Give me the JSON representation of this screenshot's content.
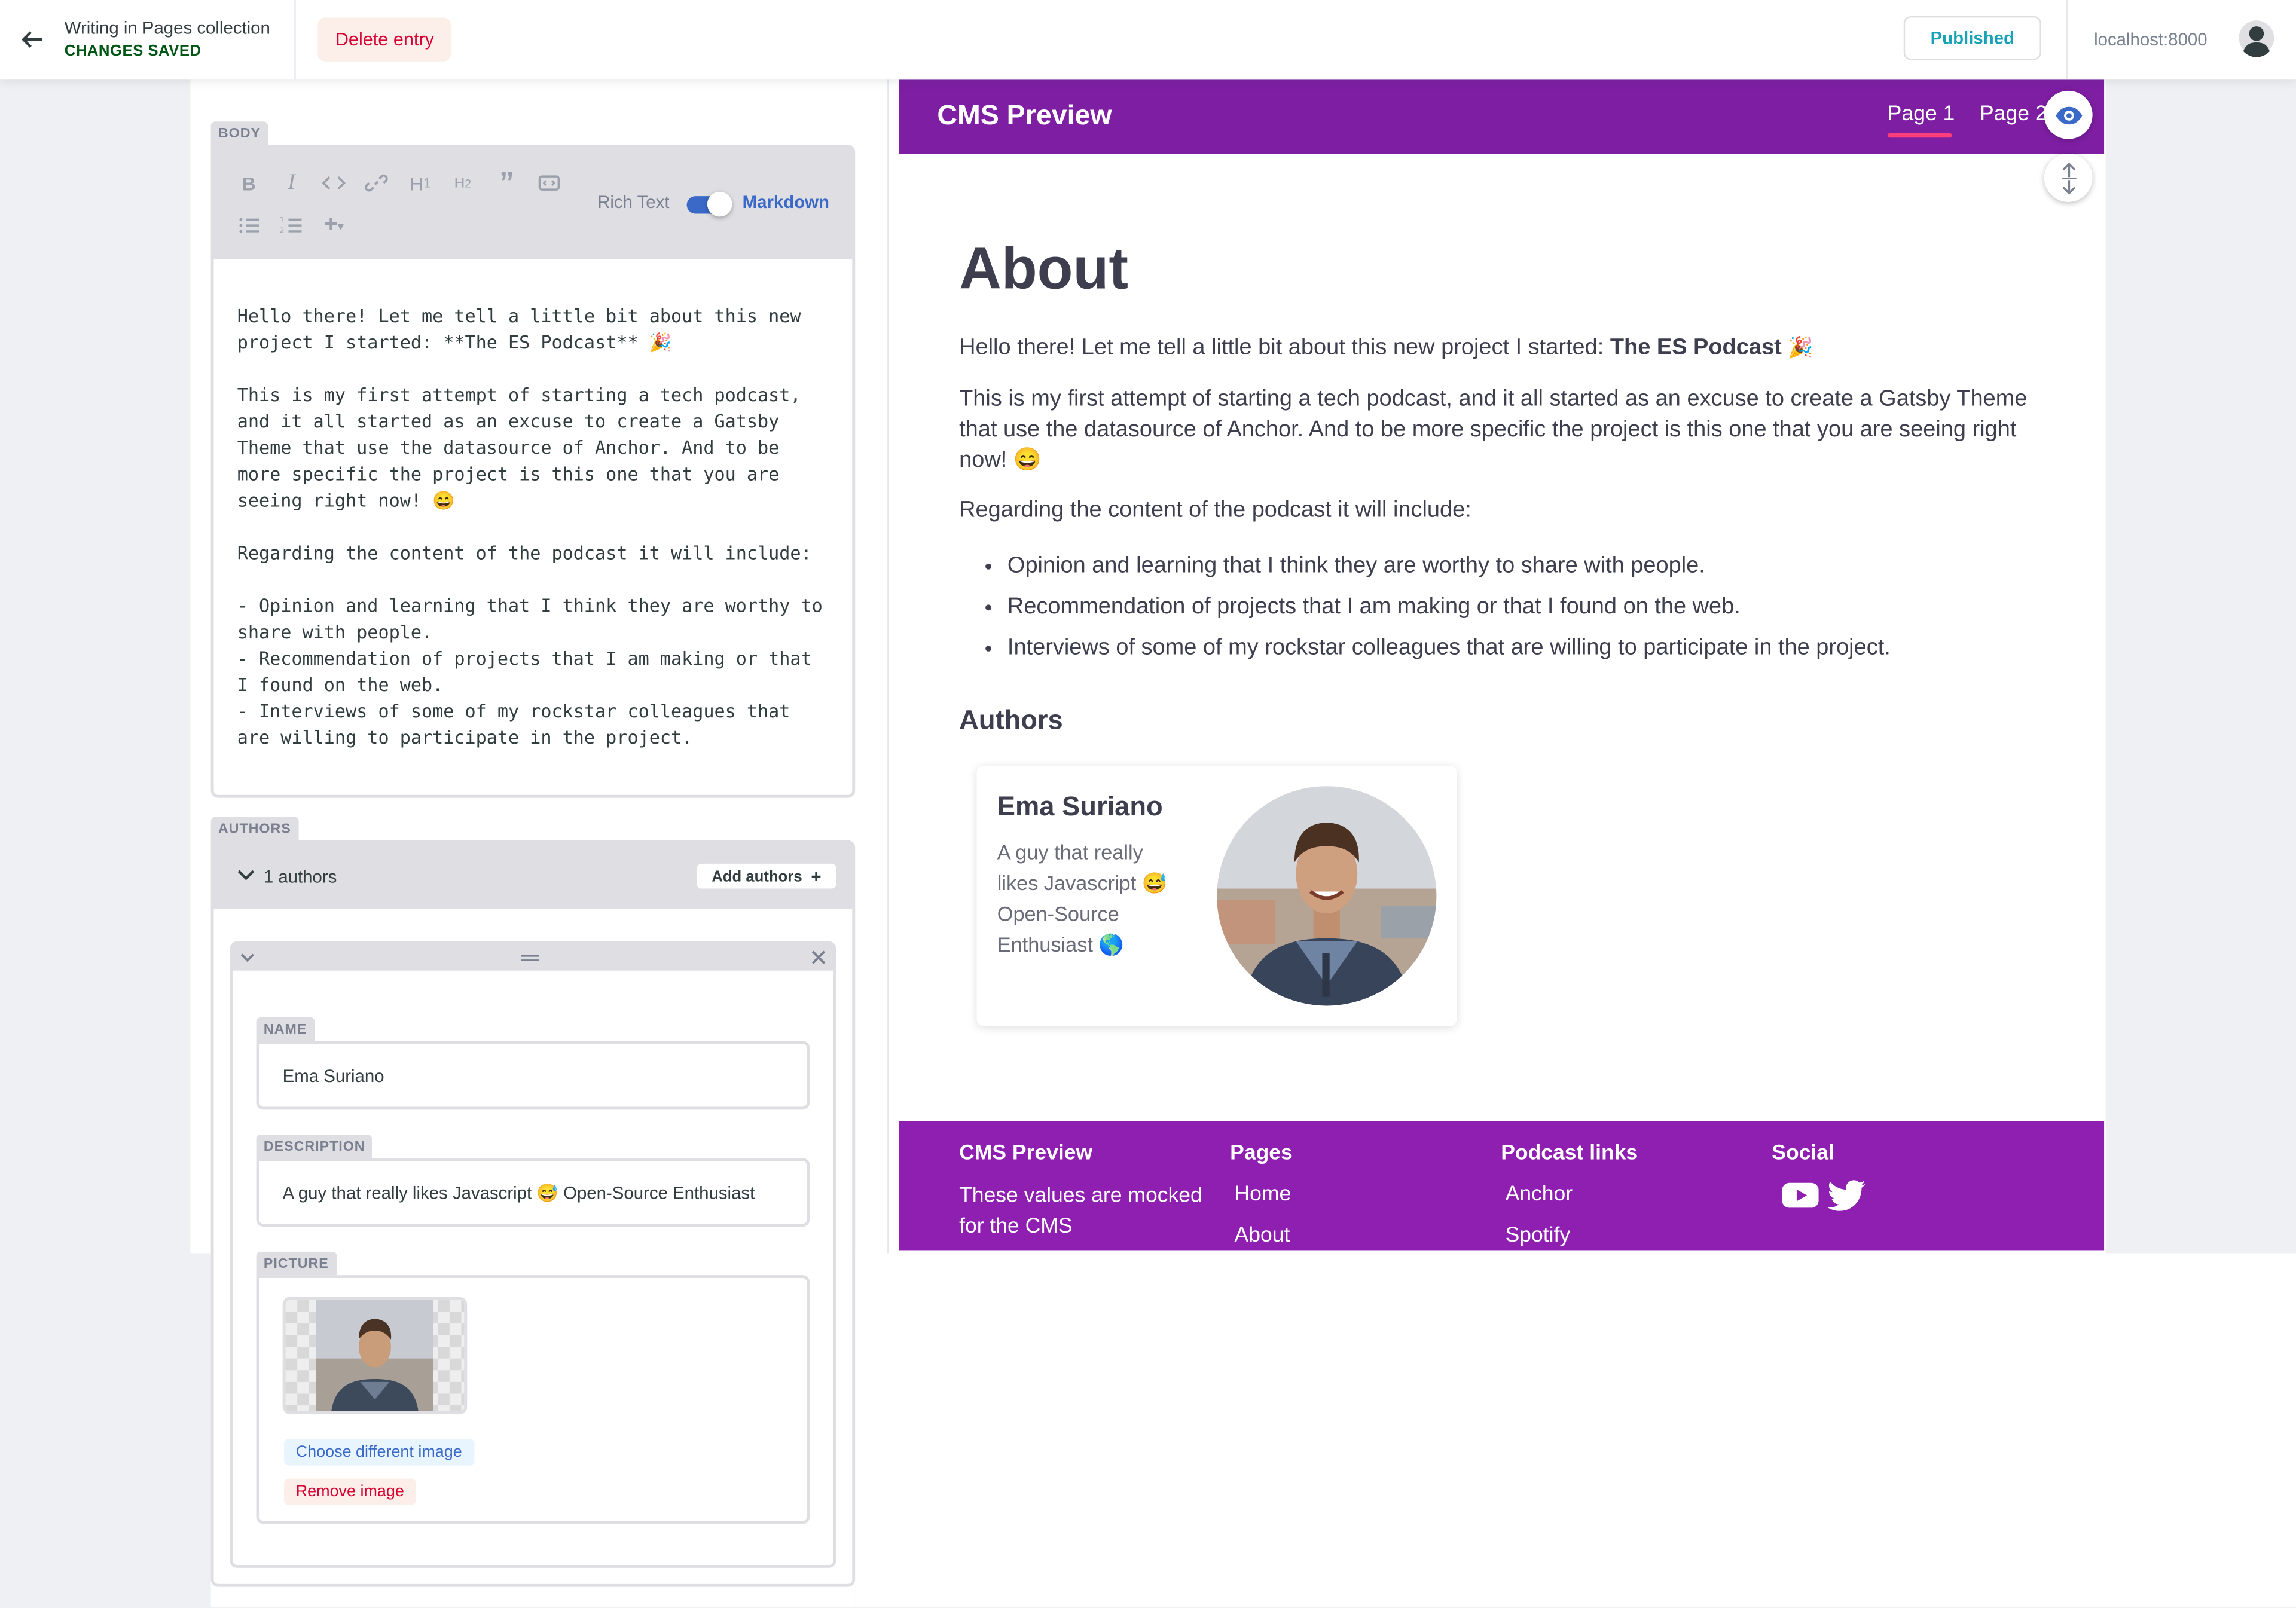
{
  "topbar": {
    "collection_title": "Writing in Pages collection",
    "save_status": "CHANGES SAVED",
    "delete_label": "Delete entry",
    "publish_status": "Published",
    "site_url": "localhost:8000"
  },
  "editor": {
    "body": {
      "label": "BODY",
      "rich_text_label": "Rich Text",
      "markdown_label": "Markdown",
      "mode": "Markdown",
      "content": "Hello there! Let me tell a little bit about this new\nproject I started: **The ES Podcast** 🎉\n\nThis is my first attempt of starting a tech podcast,\nand it all started as an excuse to create a Gatsby\nTheme that use the datasource of Anchor. And to be\nmore specific the project is this one that you are\nseeing right now! 😄\n\nRegarding the content of the podcast it will include:\n\n- Opinion and learning that I think they are worthy to\nshare with people.\n- Recommendation of projects that I am making or that\nI found on the web.\n- Interviews of some of my rockstar colleagues that\nare willing to participate in the project."
    },
    "authors": {
      "label": "AUTHORS",
      "count_label": "1 authors",
      "add_label": "Add authors",
      "item": {
        "name_label": "NAME",
        "name_value": "Ema Suriano",
        "description_label": "DESCRIPTION",
        "description_value": "A guy that really likes Javascript 😅  Open-Source Enthusiast",
        "picture_label": "PICTURE",
        "choose_label": "Choose different image",
        "remove_label": "Remove image"
      }
    }
  },
  "preview": {
    "brand": "CMS Preview",
    "nav": [
      "Page 1",
      "Page 2"
    ],
    "active_nav": "Page 1",
    "title": "About",
    "intro_prefix": "Hello there! Let me tell a little bit about this new project I started: ",
    "intro_bold": "The ES Podcast",
    "intro_emoji": "🎉",
    "paragraph_2": "This is my first attempt of starting a tech podcast, and it all started as an excuse to create a Gatsby Theme that use the datasource of Anchor. And to be more specific the project is this one that you are seeing right now! 😄",
    "paragraph_3": "Regarding the content of the podcast it will include:",
    "list": [
      "Opinion and learning that I think they are worthy to share with people.",
      "Recommendation of projects that I am making or that I found on the web.",
      "Interviews of some of my rockstar colleagues that are willing to participate in the project."
    ],
    "authors_heading": "Authors",
    "author_card": {
      "name": "Ema Suriano",
      "description": "A guy that really likes Javascript 😅 Open-Source Enthusiast 🌎"
    },
    "footer": {
      "brand": "CMS Preview",
      "brand_text": "These values are mocked for the CMS",
      "pages_title": "Pages",
      "pages": [
        "Home",
        "About"
      ],
      "podcast_title": "Podcast links",
      "podcast_links": [
        "Anchor",
        "Spotify"
      ],
      "social_title": "Social",
      "social_icons": [
        "youtube-icon",
        "twitter-icon"
      ]
    }
  },
  "colors": {
    "header_purple": "#7d1ea3",
    "footer_purple": "#8e1fb0",
    "accent_blue": "#3a69c7",
    "danger_red": "#d60032",
    "saved_green": "#005614",
    "nav_underline": "#ff3d78"
  }
}
